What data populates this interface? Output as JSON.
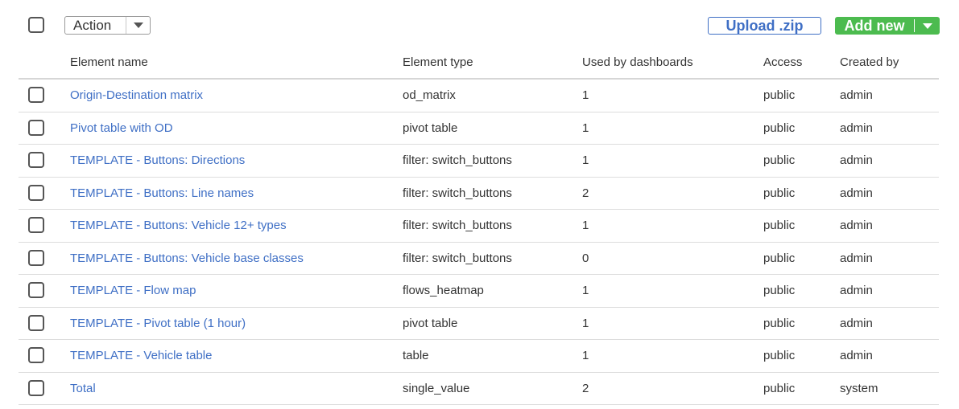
{
  "toolbar": {
    "action_label": "Action",
    "upload_label": "Upload .zip",
    "add_new_label": "Add new"
  },
  "table": {
    "columns": {
      "name": "Element name",
      "type": "Element type",
      "used": "Used by dashboards",
      "access": "Access",
      "created": "Created by"
    },
    "rows": [
      {
        "name": "Origin-Destination matrix",
        "type": "od_matrix",
        "used": "1",
        "access": "public",
        "created": "admin"
      },
      {
        "name": "Pivot table with OD",
        "type": "pivot table",
        "used": "1",
        "access": "public",
        "created": "admin"
      },
      {
        "name": "TEMPLATE - Buttons: Directions",
        "type": "filter: switch_buttons",
        "used": "1",
        "access": "public",
        "created": "admin"
      },
      {
        "name": "TEMPLATE - Buttons: Line names",
        "type": "filter: switch_buttons",
        "used": "2",
        "access": "public",
        "created": "admin"
      },
      {
        "name": "TEMPLATE - Buttons: Vehicle 12+ types",
        "type": "filter: switch_buttons",
        "used": "1",
        "access": "public",
        "created": "admin"
      },
      {
        "name": "TEMPLATE - Buttons: Vehicle base classes",
        "type": "filter: switch_buttons",
        "used": "0",
        "access": "public",
        "created": "admin"
      },
      {
        "name": "TEMPLATE - Flow map",
        "type": "flows_heatmap",
        "used": "1",
        "access": "public",
        "created": "admin"
      },
      {
        "name": "TEMPLATE - Pivot table (1 hour)",
        "type": "pivot table",
        "used": "1",
        "access": "public",
        "created": "admin"
      },
      {
        "name": "TEMPLATE - Vehicle table",
        "type": "table",
        "used": "1",
        "access": "public",
        "created": "admin"
      },
      {
        "name": "Total",
        "type": "single_value",
        "used": "2",
        "access": "public",
        "created": "system"
      }
    ]
  },
  "colors": {
    "link": "#3f6fc5",
    "primary_green": "#4cbb4f",
    "text": "#333333",
    "divider": "#dddddd"
  },
  "icons": {
    "action_caret": "caret-down-icon",
    "add_new_caret": "caret-down-icon"
  }
}
